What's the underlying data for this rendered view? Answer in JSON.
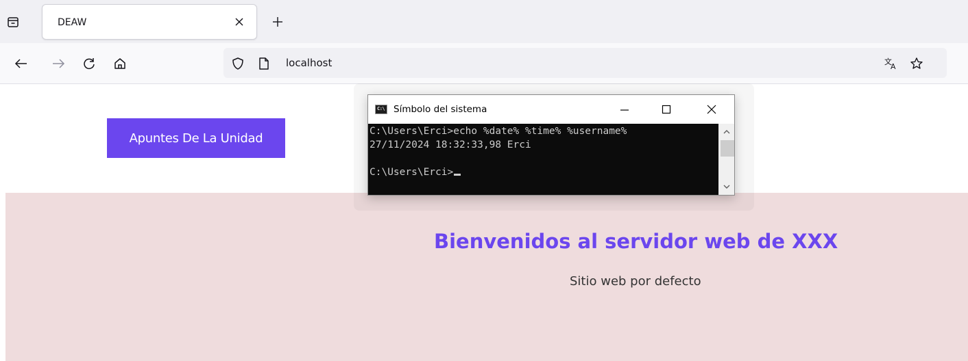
{
  "browser": {
    "tab": {
      "title": "DEAW",
      "close_icon": "close-icon"
    },
    "url": "localhost",
    "icons": [
      "tab-list-icon",
      "back-arrow-icon",
      "forward-arrow-icon",
      "reload-icon",
      "home-icon",
      "shield-icon",
      "page-icon",
      "translate-icon",
      "bookmark-star-icon",
      "new-tab-icon"
    ]
  },
  "page": {
    "button_label": "Apuntes De La Unidad",
    "heading": "Bienvenidos al servidor web de XXX",
    "subheading": "Sitio web por defecto",
    "colors": {
      "accent": "#6b46ee",
      "hero_bg": "#efdcdd",
      "subheading": "#333333"
    }
  },
  "cmd": {
    "title": "Símbolo del sistema",
    "icon_label": "C:\\",
    "lines": [
      "C:\\Users\\Erci>echo %date% %time% %username%",
      "27/11/2024 18:32:33,98 Erci",
      "",
      "C:\\Users\\Erci>"
    ],
    "colors": {
      "background": "#0c0c0c",
      "text": "#cccccc"
    }
  }
}
